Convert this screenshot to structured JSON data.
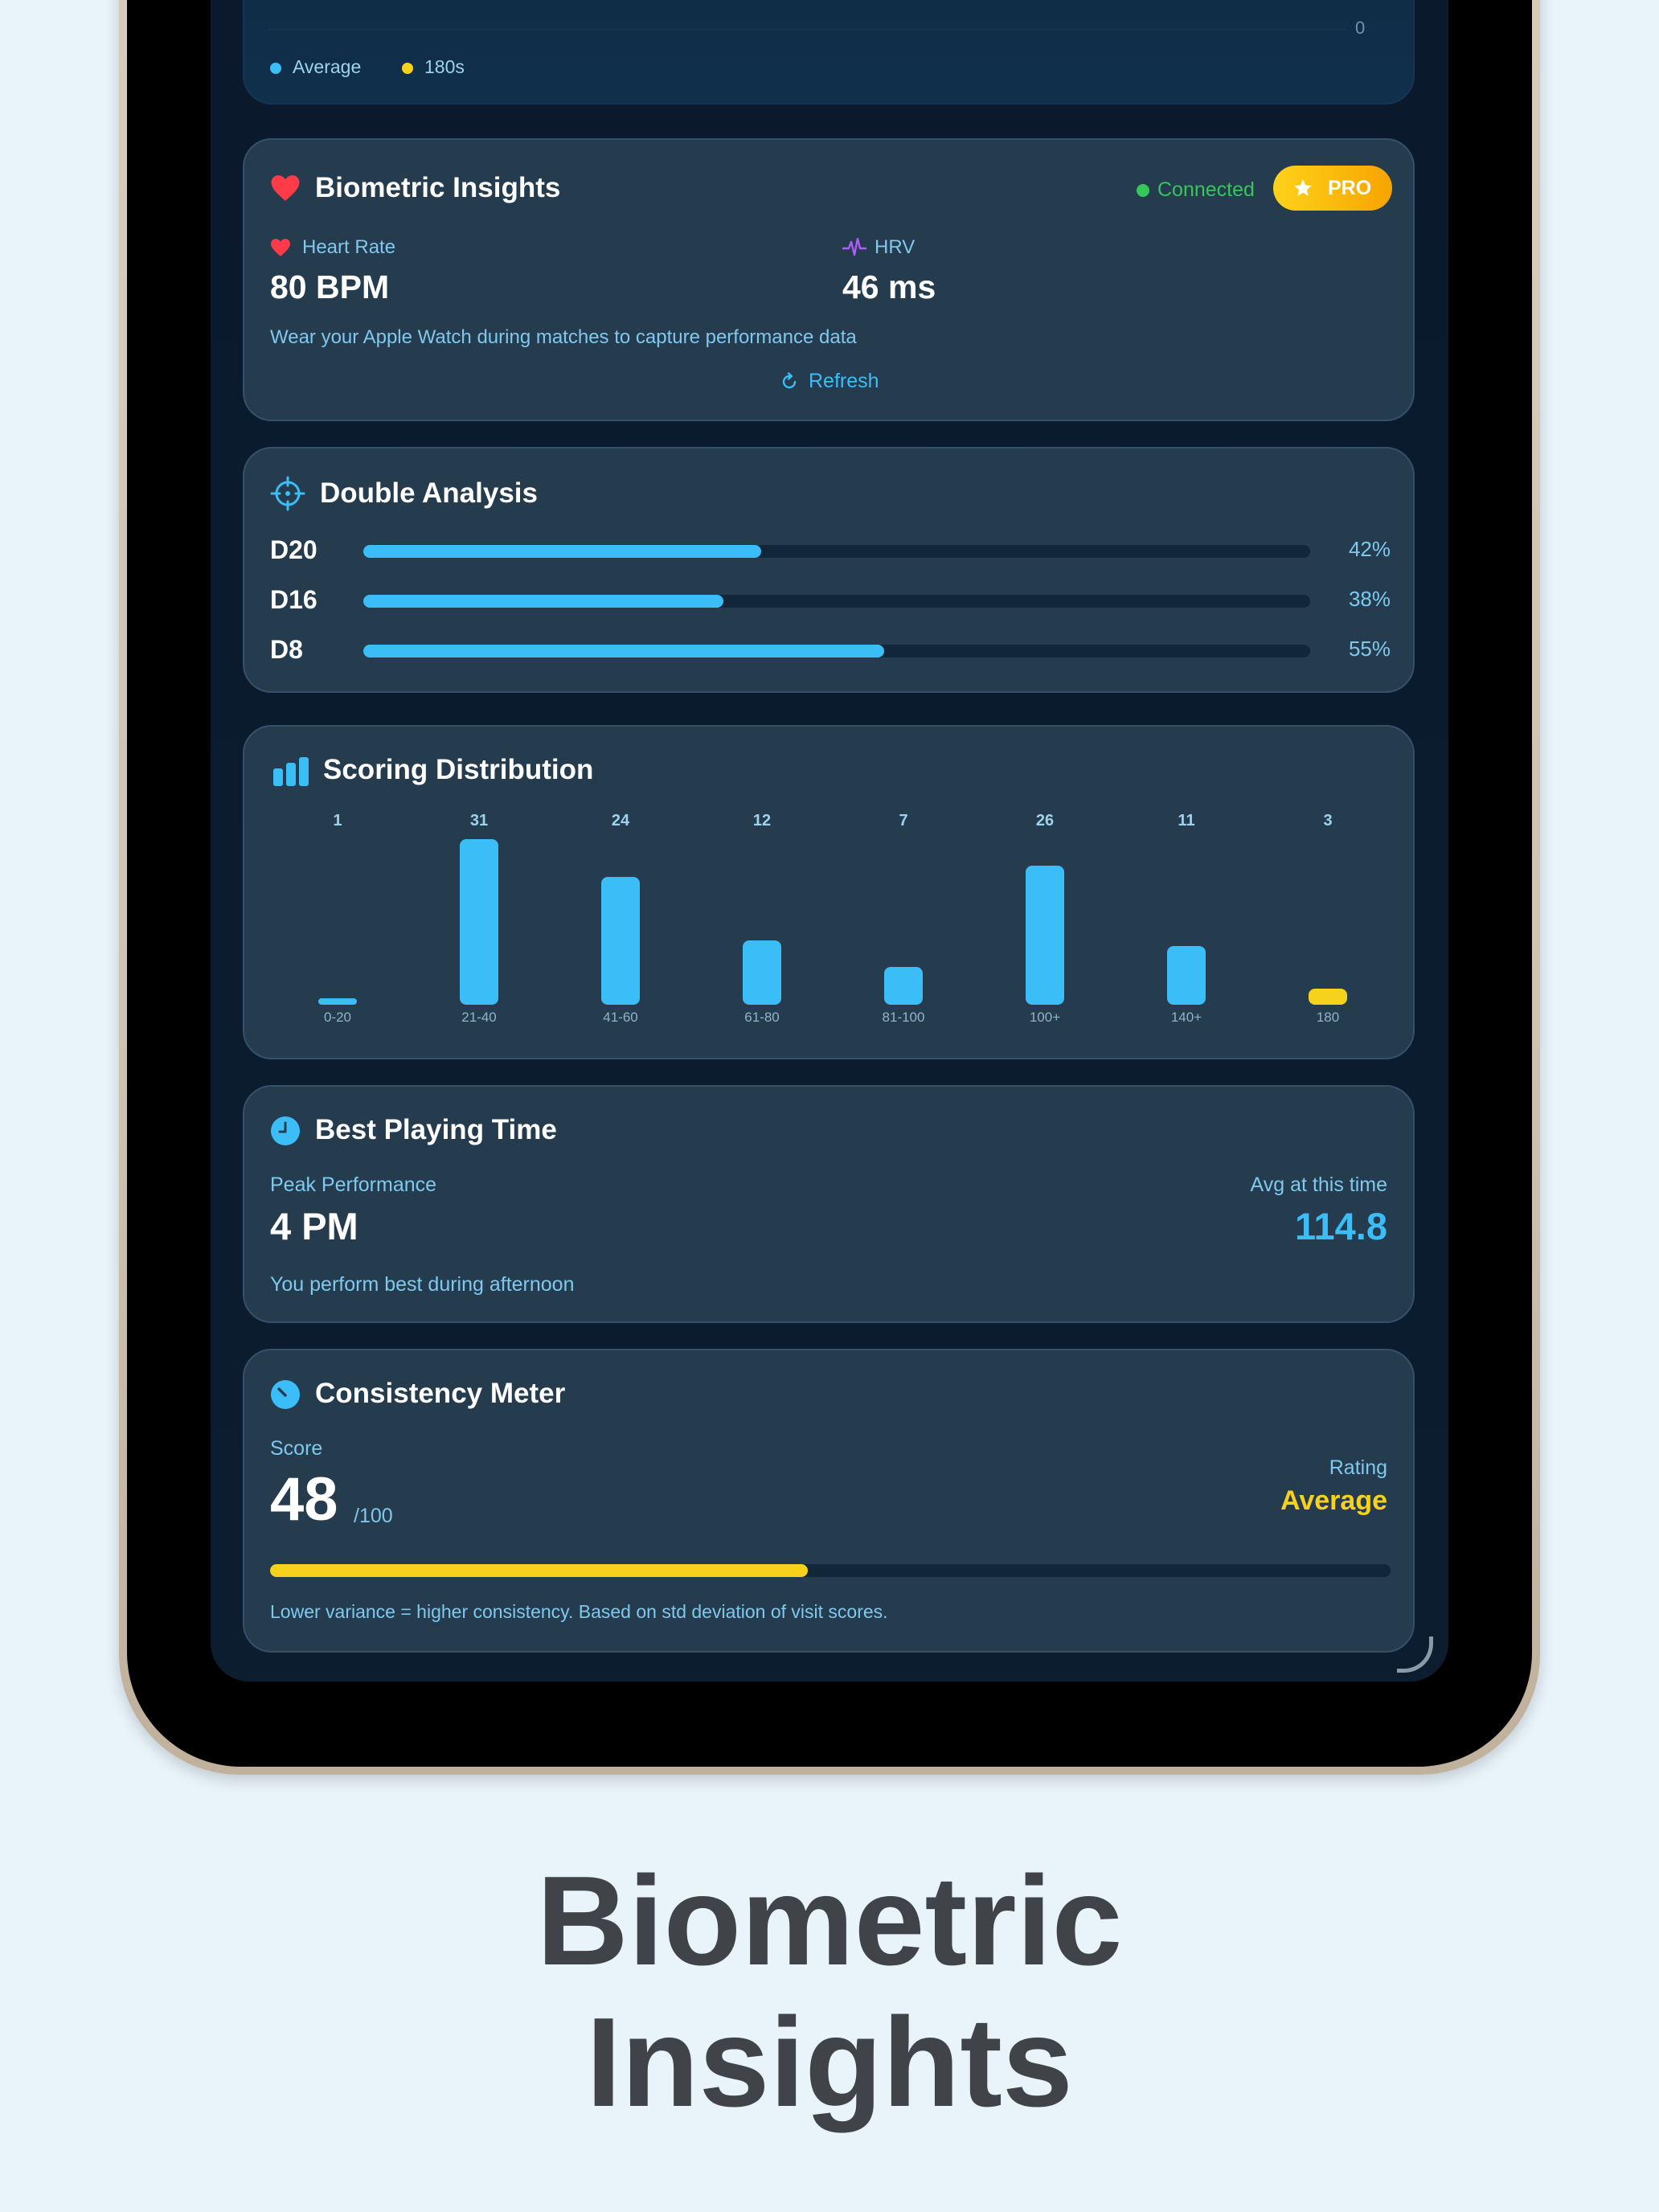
{
  "top_chart": {
    "axis_zero": "0",
    "legend": [
      {
        "label": "Average",
        "color": "#3bbdf8"
      },
      {
        "label": "180s",
        "color": "#f6d21c"
      }
    ]
  },
  "biometric": {
    "title": "Biometric Insights",
    "status": "Connected",
    "badge": "PRO",
    "heart_rate_label": "Heart Rate",
    "heart_rate_value": "80 BPM",
    "hrv_label": "HRV",
    "hrv_value": "46 ms",
    "note": "Wear your Apple Watch during matches to capture performance data",
    "refresh_label": "Refresh"
  },
  "double_analysis": {
    "title": "Double Analysis",
    "rows": [
      {
        "label": "D20",
        "pct_text": "42%",
        "value": 0.42
      },
      {
        "label": "D16",
        "pct_text": "38%",
        "value": 0.38
      },
      {
        "label": "D8",
        "pct_text": "55%",
        "value": 0.55
      }
    ]
  },
  "scoring_distribution": {
    "title": "Scoring Distribution"
  },
  "chart_data": {
    "type": "bar",
    "title": "Scoring Distribution",
    "categories": [
      "0-20",
      "21-40",
      "41-60",
      "61-80",
      "81-100",
      "100+",
      "140+",
      "180"
    ],
    "values": [
      1,
      31,
      24,
      12,
      7,
      26,
      11,
      3
    ],
    "colors": [
      "#3bbdf8",
      "#3bbdf8",
      "#3bbdf8",
      "#3bbdf8",
      "#3bbdf8",
      "#3bbdf8",
      "#3bbdf8",
      "#f6d21c"
    ]
  },
  "best_time": {
    "title": "Best Playing Time",
    "peak_label": "Peak Performance",
    "peak_value": "4 PM",
    "avg_label": "Avg at this time",
    "avg_value": "114.8",
    "note": "You perform best during afternoon"
  },
  "consistency": {
    "title": "Consistency Meter",
    "score_label": "Score",
    "score_value": "48",
    "score_max": "/100",
    "score_fraction": 0.48,
    "rating_label": "Rating",
    "rating_value": "Average",
    "note": "Lower variance = higher consistency. Based on std deviation of visit scores."
  },
  "caption": {
    "line1": "Biometric",
    "line2": "Insights"
  },
  "colors": {
    "accent": "#3bbdf8",
    "gold": "#f6d21c",
    "connected": "#34c759",
    "heart": "#ff3b4a",
    "hrv": "#b05cff",
    "pro_gradient_start": "#ffd21a",
    "pro_gradient_end": "#f6a400"
  }
}
